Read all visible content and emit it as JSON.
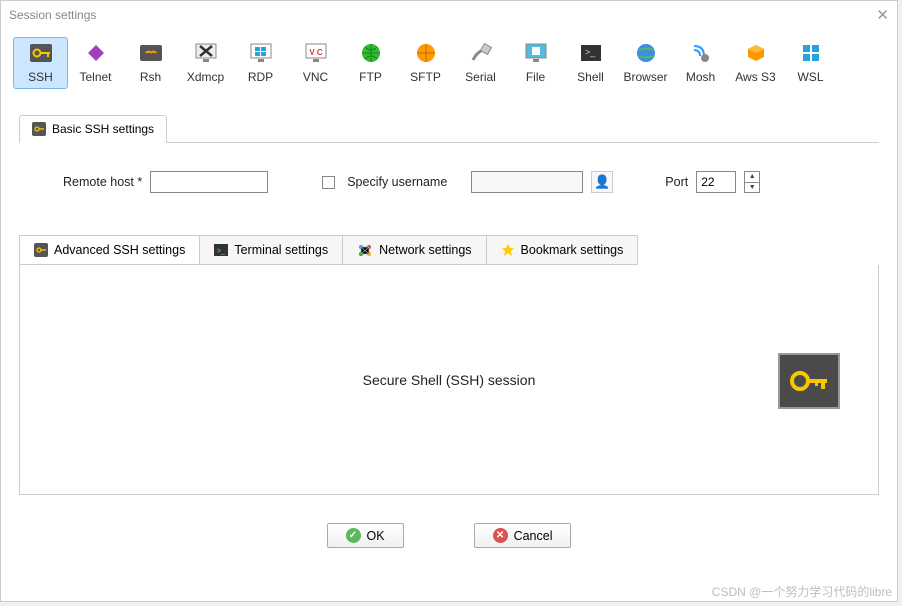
{
  "title": "Session settings",
  "toolbar": [
    {
      "id": "ssh",
      "label": "SSH",
      "selected": true
    },
    {
      "id": "telnet",
      "label": "Telnet"
    },
    {
      "id": "rsh",
      "label": "Rsh"
    },
    {
      "id": "xdmcp",
      "label": "Xdmcp"
    },
    {
      "id": "rdp",
      "label": "RDP"
    },
    {
      "id": "vnc",
      "label": "VNC"
    },
    {
      "id": "ftp",
      "label": "FTP"
    },
    {
      "id": "sftp",
      "label": "SFTP"
    },
    {
      "id": "serial",
      "label": "Serial"
    },
    {
      "id": "file",
      "label": "File"
    },
    {
      "id": "shell",
      "label": "Shell"
    },
    {
      "id": "browser",
      "label": "Browser"
    },
    {
      "id": "mosh",
      "label": "Mosh"
    },
    {
      "id": "awss3",
      "label": "Aws S3"
    },
    {
      "id": "wsl",
      "label": "WSL"
    }
  ],
  "basic_tab_label": "Basic SSH settings",
  "form": {
    "remote_host_label": "Remote host *",
    "remote_host_value": "",
    "specify_user_label": "Specify username",
    "specify_user_checked": false,
    "username_value": "",
    "port_label": "Port",
    "port_value": "22"
  },
  "setting_tabs": [
    {
      "id": "adv",
      "label": "Advanced SSH settings"
    },
    {
      "id": "term",
      "label": "Terminal settings"
    },
    {
      "id": "net",
      "label": "Network settings"
    },
    {
      "id": "bm",
      "label": "Bookmark settings"
    }
  ],
  "session_description": "Secure Shell (SSH) session",
  "buttons": {
    "ok": "OK",
    "cancel": "Cancel"
  },
  "watermark": "CSDN @一个努力学习代码的libre"
}
